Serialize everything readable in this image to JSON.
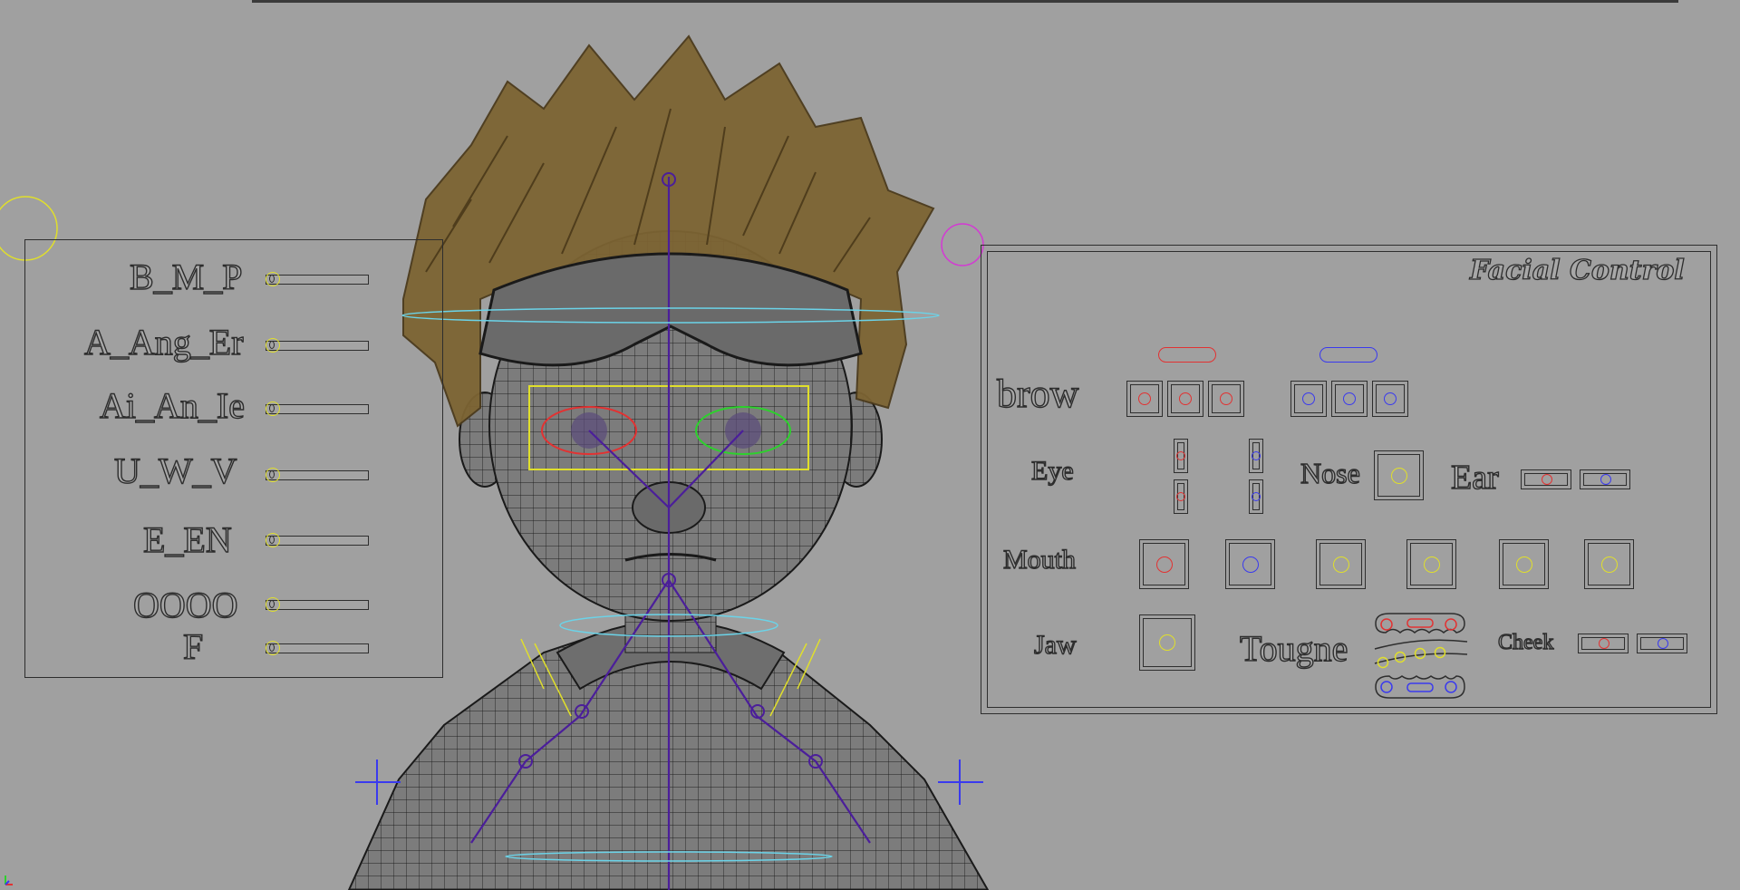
{
  "left_panel": {
    "sliders": [
      {
        "label": "B_M_P"
      },
      {
        "label": "A_Ang_Er"
      },
      {
        "label": "Ai_An_Ie"
      },
      {
        "label": "U_W_V"
      },
      {
        "label": "E_EN"
      },
      {
        "label": "OOOO"
      },
      {
        "label": "F"
      }
    ]
  },
  "facial_control": {
    "title": "Facial Control",
    "brow": "brow",
    "eye": "Eye",
    "nose": "Nose",
    "ear": "Ear",
    "mouth": "Mouth",
    "jaw": "Jaw",
    "tongue": "Tougne",
    "cheek": "Cheek"
  },
  "colors": {
    "left_side": "#e23232",
    "right_side": "#3a3aee",
    "center": "#e0df2b",
    "outline": "#2e2e2e",
    "background": "#a0a0a0"
  }
}
